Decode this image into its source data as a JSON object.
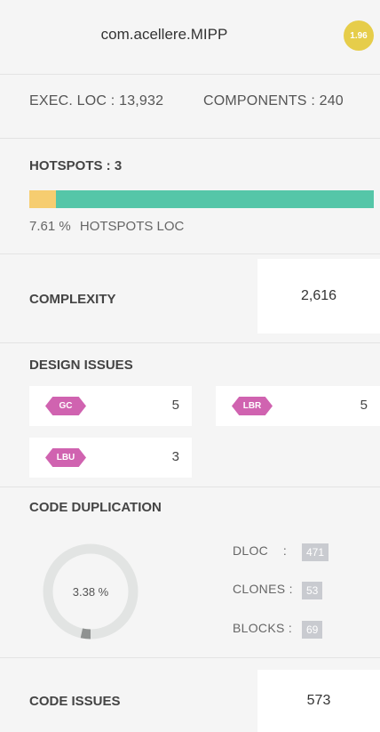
{
  "header": {
    "app_name": "com.acellere.MIPP",
    "score": "1.96"
  },
  "stats": {
    "exec_loc": "EXEC. LOC : 13,932",
    "components": "COMPONENTS : 240"
  },
  "hotspots": {
    "title": "HOTSPOTS : 3",
    "percent": 7.61,
    "percent_text": "7.61 %",
    "caption": "HOTSPOTS LOC",
    "colors": {
      "hot": "#f6cd70",
      "rest": "#55c6a8"
    }
  },
  "complexity": {
    "label": "COMPLEXITY",
    "value": "2,616"
  },
  "design_issues": {
    "title": "DESIGN ISSUES",
    "items": [
      {
        "tag": "GC",
        "count": "5"
      },
      {
        "tag": "LBR",
        "count": "5"
      },
      {
        "tag": "LBU",
        "count": "3"
      }
    ],
    "tag_color": "#d063b0"
  },
  "code_duplication": {
    "title": "CODE DUPLICATION",
    "percent": 3.38,
    "percent_text": "3.38 %",
    "metrics": [
      {
        "label": "DLOC",
        "sep": ":",
        "value": "471"
      },
      {
        "label": "CLONES",
        "sep": ":",
        "value": "53"
      },
      {
        "label": "BLOCKS",
        "sep": ":",
        "value": "69"
      }
    ]
  },
  "code_issues": {
    "label": "CODE ISSUES",
    "value": "573"
  }
}
